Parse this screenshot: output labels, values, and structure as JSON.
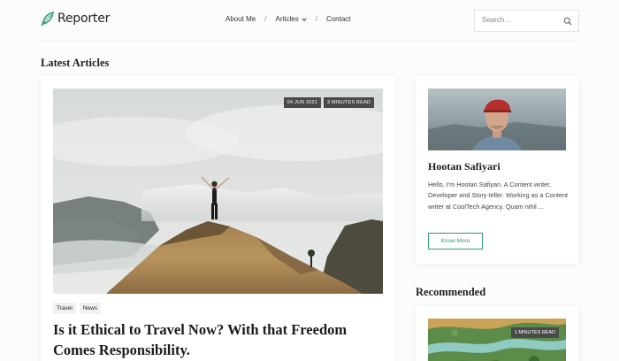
{
  "brand": {
    "name": "Reporter",
    "logo_icon": "leaf-icon",
    "accent": "#2e9c6a"
  },
  "nav": {
    "items": [
      {
        "label": "About Me"
      },
      {
        "label": "Articles"
      },
      {
        "label": "Contact"
      }
    ],
    "separator": "/"
  },
  "search": {
    "placeholder": "Search...",
    "icon": "search-icon"
  },
  "latest": {
    "heading": "Latest Articles",
    "article": {
      "date": "04 JUN 2021",
      "read_time": "3 MINUTES READ",
      "tags": [
        "Travel",
        "News"
      ],
      "title": "Is it Ethical to Travel Now? With that Freedom Comes Responsibility."
    }
  },
  "author": {
    "name": "Hootan Safiyari",
    "bio": "Hello, I'm Hootan Safiyari. A Content writer, Developer and Story teller. Working as a Content writer at CoolTech Agency. Quam nihil ...",
    "button": "Know More"
  },
  "recommended": {
    "heading": "Recommended",
    "read_time": "1 MINUTES READ"
  }
}
